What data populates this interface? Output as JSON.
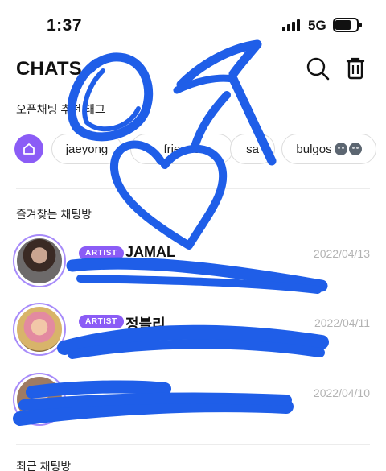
{
  "status_bar": {
    "time": "1:37",
    "network": "5G"
  },
  "header": {
    "title": "CHATS",
    "search_icon": "search-icon",
    "trash_icon": "trash-icon"
  },
  "tags_section": {
    "title": "오픈채팅 추천 태그",
    "home_icon": "home-icon",
    "tags": [
      "jaeyong",
      "friends",
      "sa",
      "bulgos"
    ]
  },
  "favorites_section": {
    "title": "즐겨찾는 채팅방",
    "chats": [
      {
        "badge": "ARTIST",
        "name": "JAMAL",
        "date": "2022/04/13"
      },
      {
        "badge": "ARTIST",
        "name": "정블리",
        "date": "2022/04/11"
      },
      {
        "badge": "",
        "name": "",
        "date": "2022/04/10"
      }
    ]
  },
  "recent_section": {
    "title": "최근 채팅방"
  },
  "colors": {
    "accent": "#8b5cf6",
    "scribble": "#1f5ee8"
  }
}
